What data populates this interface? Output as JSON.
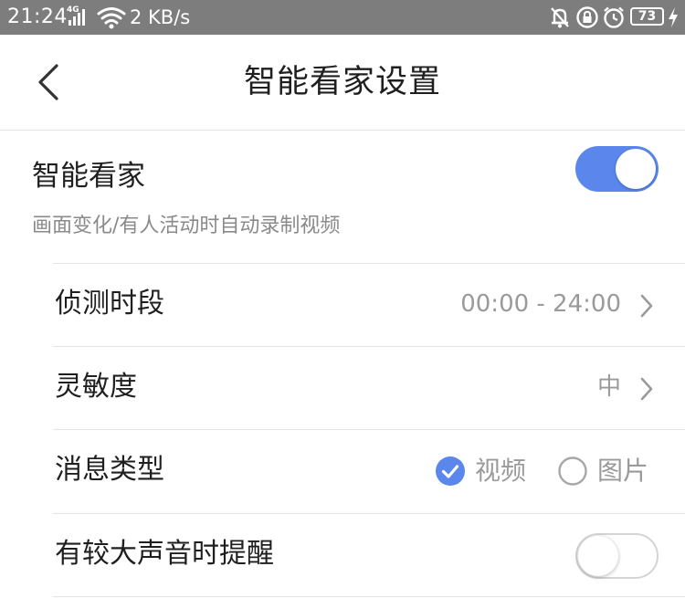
{
  "status_bar": {
    "time": "21:24",
    "network_type": "4G",
    "net_speed": "2 KB/s",
    "battery_level": "73",
    "icons": [
      "signal-icon",
      "wifi-icon",
      "alarm-off-icon",
      "lock-rotation-icon",
      "clock-icon",
      "battery-icon",
      "charging-icon"
    ]
  },
  "nav": {
    "title": "智能看家设置",
    "back_icon": "chevron-left-icon"
  },
  "smart_home_watch": {
    "label": "智能看家",
    "description": "画面变化/有人活动时自动录制视频",
    "enabled": true
  },
  "settings": {
    "detection_period": {
      "label": "侦测时段",
      "value": "00:00 - 24:00"
    },
    "sensitivity": {
      "label": "灵敏度",
      "value": "中"
    },
    "message_type": {
      "label": "消息类型",
      "options": [
        {
          "label": "视频",
          "selected": true
        },
        {
          "label": "图片",
          "selected": false
        }
      ]
    },
    "loud_sound_alert": {
      "label": "有较大声音时提醒",
      "enabled": false
    }
  },
  "colors": {
    "accent": "#5b87ec",
    "status_bar": "#7d7d7d",
    "secondary_text": "#9a9a9a"
  }
}
